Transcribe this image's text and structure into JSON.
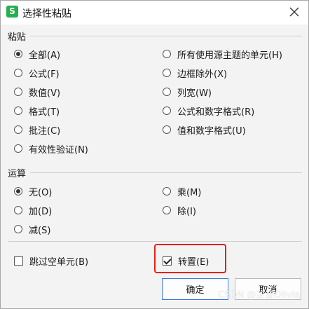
{
  "dialog": {
    "app_icon_letter": "S",
    "title": "选择性粘贴"
  },
  "paste_group": {
    "title": "粘贴",
    "options": [
      {
        "label": "全部(A)",
        "checked": true
      },
      {
        "label": "所有使用源主题的单元(H)",
        "checked": false
      },
      {
        "label": "公式(F)",
        "checked": false
      },
      {
        "label": "边框除外(X)",
        "checked": false
      },
      {
        "label": "数值(V)",
        "checked": false
      },
      {
        "label": "列宽(W)",
        "checked": false
      },
      {
        "label": "格式(T)",
        "checked": false
      },
      {
        "label": "公式和数字格式(R)",
        "checked": false
      },
      {
        "label": "批注(C)",
        "checked": false
      },
      {
        "label": "值和数字格式(U)",
        "checked": false
      },
      {
        "label": "有效性验证(N)",
        "checked": false
      }
    ]
  },
  "operation_group": {
    "title": "运算",
    "options": [
      {
        "label": "无(O)",
        "checked": true
      },
      {
        "label": "乘(M)",
        "checked": false
      },
      {
        "label": "加(D)",
        "checked": false
      },
      {
        "label": "除(I)",
        "checked": false
      },
      {
        "label": "减(S)",
        "checked": false
      }
    ]
  },
  "checkboxes": {
    "skip_blanks": {
      "label": "跳过空单元(B)",
      "checked": false
    },
    "transpose": {
      "label": "转置(E)",
      "checked": true
    }
  },
  "buttons": {
    "ok": "确定",
    "cancel": "取消"
  },
  "watermark": "CSDN @芷昔Olivia",
  "colors": {
    "highlight": "#e0201b",
    "primary_border": "#3b7bd8",
    "app_icon": "#22b14c"
  }
}
